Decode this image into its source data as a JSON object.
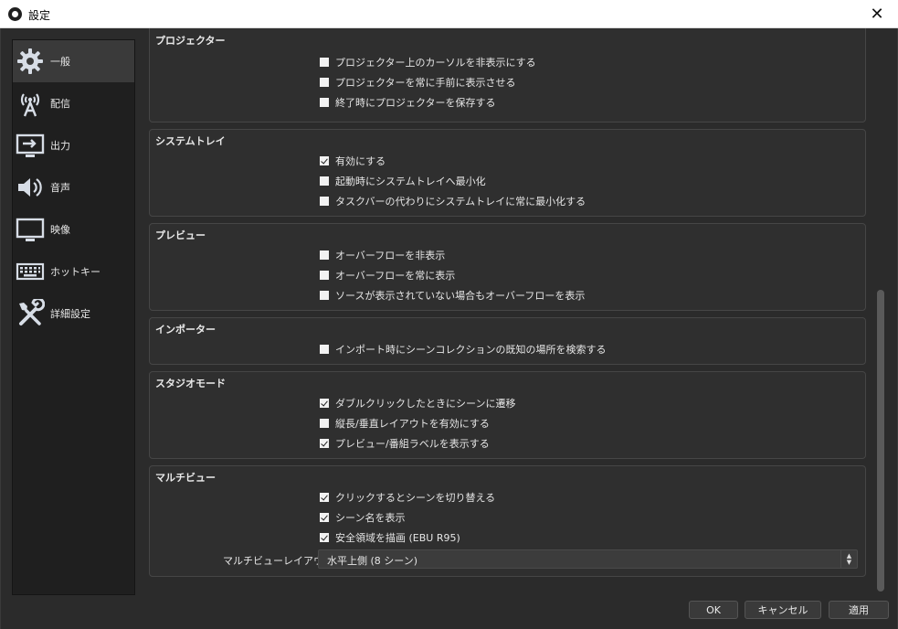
{
  "window": {
    "title": "設定",
    "close_glyph": "✕"
  },
  "sidebar": {
    "items": [
      {
        "label": "一般",
        "icon": "gear-icon",
        "active": true
      },
      {
        "label": "配信",
        "icon": "broadcast-antenna-icon"
      },
      {
        "label": "出力",
        "icon": "output-monitor-icon"
      },
      {
        "label": "音声",
        "icon": "speaker-icon"
      },
      {
        "label": "映像",
        "icon": "display-icon"
      },
      {
        "label": "ホットキー",
        "icon": "keyboard-icon"
      },
      {
        "label": "詳細設定",
        "icon": "tools-icon"
      }
    ]
  },
  "groups": {
    "projector": {
      "title": "プロジェクター",
      "options": [
        {
          "label": "プロジェクター上のカーソルを非表示にする",
          "checked": false
        },
        {
          "label": "プロジェクターを常に手前に表示させる",
          "checked": false
        },
        {
          "label": "終了時にプロジェクターを保存する",
          "checked": false
        }
      ]
    },
    "tray": {
      "title": "システムトレイ",
      "options": [
        {
          "label": "有効にする",
          "checked": true
        },
        {
          "label": "起動時にシステムトレイへ最小化",
          "checked": false
        },
        {
          "label": "タスクバーの代わりにシステムトレイに常に最小化する",
          "checked": false
        }
      ]
    },
    "preview": {
      "title": "プレビュー",
      "options": [
        {
          "label": "オーバーフローを非表示",
          "checked": false
        },
        {
          "label": "オーバーフローを常に表示",
          "checked": false
        },
        {
          "label": "ソースが表示されていない場合もオーバーフローを表示",
          "checked": false
        }
      ]
    },
    "importer": {
      "title": "インポーター",
      "options": [
        {
          "label": "インポート時にシーンコレクションの既知の場所を検索する",
          "checked": false
        }
      ]
    },
    "studio": {
      "title": "スタジオモード",
      "options": [
        {
          "label": "ダブルクリックしたときにシーンに遷移",
          "checked": true
        },
        {
          "label": "縦長/垂直レイアウトを有効にする",
          "checked": false
        },
        {
          "label": "プレビュー/番組ラベルを表示する",
          "checked": true
        }
      ]
    },
    "multiview": {
      "title": "マルチビュー",
      "options": [
        {
          "label": "クリックするとシーンを切り替える",
          "checked": true
        },
        {
          "label": "シーン名を表示",
          "checked": true
        },
        {
          "label": "安全領域を描画 (EBU R95)",
          "checked": true
        }
      ],
      "layout_label": "マルチビューレイアウト",
      "layout_value": "水平上側 (8 シーン)"
    }
  },
  "buttons": {
    "ok": "OK",
    "cancel": "キャンセル",
    "apply": "適用"
  }
}
